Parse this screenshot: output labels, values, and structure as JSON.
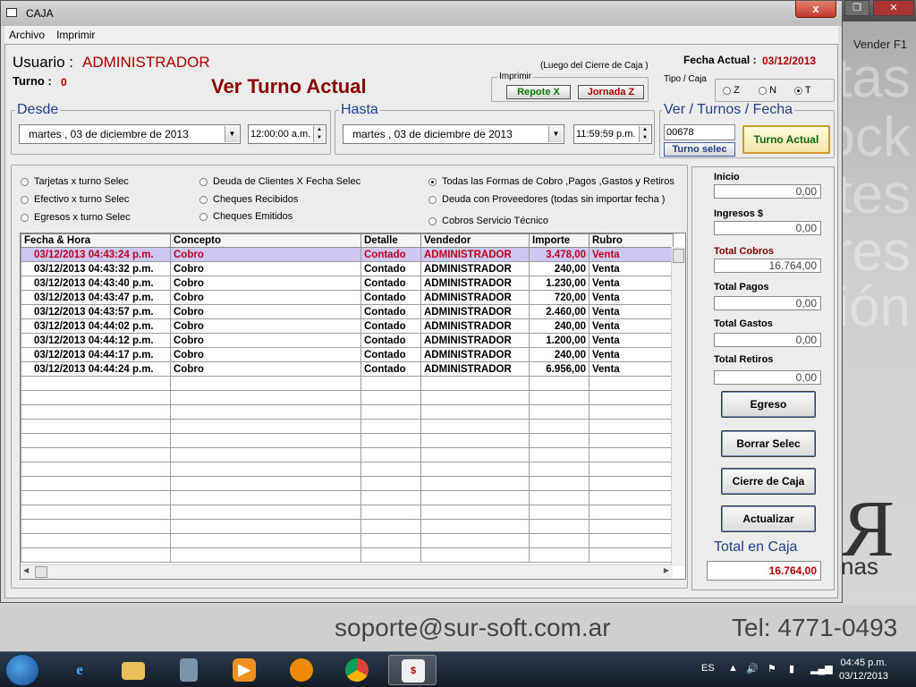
{
  "window": {
    "title": "CAJA",
    "close_label": "x"
  },
  "menu": [
    "Archivo",
    "Imprimir"
  ],
  "background": {
    "vender_label": "Vender F1",
    "words": [
      "tas",
      "ock",
      "tes",
      "res",
      "ión"
    ],
    "email": "soporte@sur-soft.com.ar",
    "tel": "Tel: 4771-0493",
    "logo_letter": "R",
    "logo_text": "nas"
  },
  "header": {
    "usuario_label": "Usuario :",
    "usuario_value": "ADMINISTRADOR",
    "turno_label": "Turno :",
    "turno_value": "0",
    "title": "Ver Turno Actual",
    "luego_note": "(Luego del Cierre de Caja )",
    "fecha_label": "Fecha Actual :",
    "fecha_value": "03/12/2013"
  },
  "imprimir": {
    "caption": "Imprimir",
    "repote_label": "Repote  X",
    "jornada_label": "Jornada Z"
  },
  "tipo_caja": {
    "caption": "Tipo / Caja",
    "options": [
      "Z",
      "N",
      "T"
    ],
    "selected": "T"
  },
  "desde": {
    "caption": "Desde",
    "date": "martes   , 03 de  diciembre  de 2013",
    "time": "12:00:00 a.m."
  },
  "hasta": {
    "caption": "Hasta",
    "date": "martes   , 03 de  diciembre  de 2013",
    "time": "11:59:59 p.m."
  },
  "turnos": {
    "caption": "Ver / Turnos / Fecha",
    "turno_input": "00678",
    "turno_selec_label": "Turno selec",
    "turno_actual_label": "Turno Actual"
  },
  "filters": {
    "col1": [
      "Tarjetas x turno Selec",
      "Efectivo  x turno Selec",
      "Egresos  x turno Selec"
    ],
    "col2": [
      "Deuda de Clientes X Fecha Selec",
      "Cheques Recibidos",
      "Cheques Emitidos"
    ],
    "col3": [
      "Todas las Formas de Cobro ,Pagos ,Gastos y Retiros",
      "Deuda con Proveedores (todas  sin importar  fecha )",
      "Cobros Servicio Técnico"
    ],
    "selected": "Todas las Formas de Cobro ,Pagos ,Gastos y Retiros"
  },
  "table": {
    "columns": [
      "Fecha      &        Hora",
      "Concepto",
      "Detalle",
      "Vendedor",
      "Importe",
      "Rubro"
    ],
    "rows": [
      [
        "03/12/2013 04:43:24 p.m.",
        "Cobro",
        "Contado",
        "ADMINISTRADOR",
        "3.478,00",
        "Venta"
      ],
      [
        "03/12/2013 04:43:32 p.m.",
        "Cobro",
        "Contado",
        "ADMINISTRADOR",
        "240,00",
        "Venta"
      ],
      [
        "03/12/2013 04:43:40 p.m.",
        "Cobro",
        "Contado",
        "ADMINISTRADOR",
        "1.230,00",
        "Venta"
      ],
      [
        "03/12/2013 04:43:47 p.m.",
        "Cobro",
        "Contado",
        "ADMINISTRADOR",
        "720,00",
        "Venta"
      ],
      [
        "03/12/2013 04:43:57 p.m.",
        "Cobro",
        "Contado",
        "ADMINISTRADOR",
        "2.460,00",
        "Venta"
      ],
      [
        "03/12/2013 04:44:02 p.m.",
        "Cobro",
        "Contado",
        "ADMINISTRADOR",
        "240,00",
        "Venta"
      ],
      [
        "03/12/2013 04:44:12 p.m.",
        "Cobro",
        "Contado",
        "ADMINISTRADOR",
        "1.200,00",
        "Venta"
      ],
      [
        "03/12/2013 04:44:17 p.m.",
        "Cobro",
        "Contado",
        "ADMINISTRADOR",
        "240,00",
        "Venta"
      ],
      [
        "03/12/2013 04:44:24 p.m.",
        "Cobro",
        "Contado",
        "ADMINISTRADOR",
        "6.956,00",
        "Venta"
      ]
    ],
    "selected_row": 0,
    "empty_rows": 13
  },
  "totals": {
    "inicio_label": "Inicio",
    "inicio_value": "0,00",
    "ingresos_label": "Ingresos $",
    "ingresos_value": "0,00",
    "cobros_label": "Total Cobros",
    "cobros_value": "16.764,00",
    "pagos_label": "Total Pagos",
    "pagos_value": "0,00",
    "gastos_label": "Total Gastos",
    "gastos_value": "0,00",
    "retiros_label": "Total Retiros",
    "retiros_value": "0,00",
    "caja_label": "Total en Caja",
    "caja_value": "16.764,00"
  },
  "buttons": {
    "egreso": "Egreso",
    "borrar": "Borrar Selec",
    "cierre": "Cierre de Caja",
    "actualizar": "Actualizar"
  },
  "taskbar": {
    "apps": [
      "internet-explorer",
      "file-explorer",
      "calculator",
      "media-player",
      "vlc",
      "chrome",
      "caja-app"
    ],
    "lang": "ES",
    "time": "04:45 p.m.",
    "date": "03/12/2013"
  },
  "colors": {
    "accent_red": "#b00000",
    "title_red": "#8b0000",
    "header_blue": "#1f3e8c",
    "selected_row": "#cdc8f0"
  }
}
